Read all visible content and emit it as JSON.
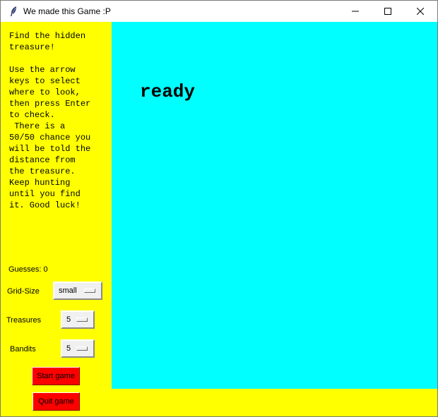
{
  "window": {
    "title": "We made this Game :P",
    "icon": "feather-icon",
    "controls": [
      "minimize-icon",
      "maximize-icon",
      "close-icon"
    ]
  },
  "sidebar": {
    "instructions": "Find the hidden\ntreasure!\n\nUse the arrow\nkeys to select\nwhere to look,\nthen press Enter\nto check.\n There is a\n50/50 chance you\nwill be told the\ndistance from\nthe treasure.\nKeep hunting\nuntil you find\nit. Good luck!",
    "guesses_label": "Guesses: 0",
    "grid_size": {
      "label": "Grid-Size",
      "value": "small"
    },
    "treasures": {
      "label": "Treasures",
      "value": "5"
    },
    "bandits": {
      "label": "Bandits",
      "value": "5"
    },
    "start_button": "Start game",
    "quit_button": "Quit game"
  },
  "canvas": {
    "status": "ready"
  },
  "colors": {
    "sidebar_bg": "#ffff00",
    "canvas_bg": "#00ffff",
    "button_bg": "#ff0000"
  }
}
